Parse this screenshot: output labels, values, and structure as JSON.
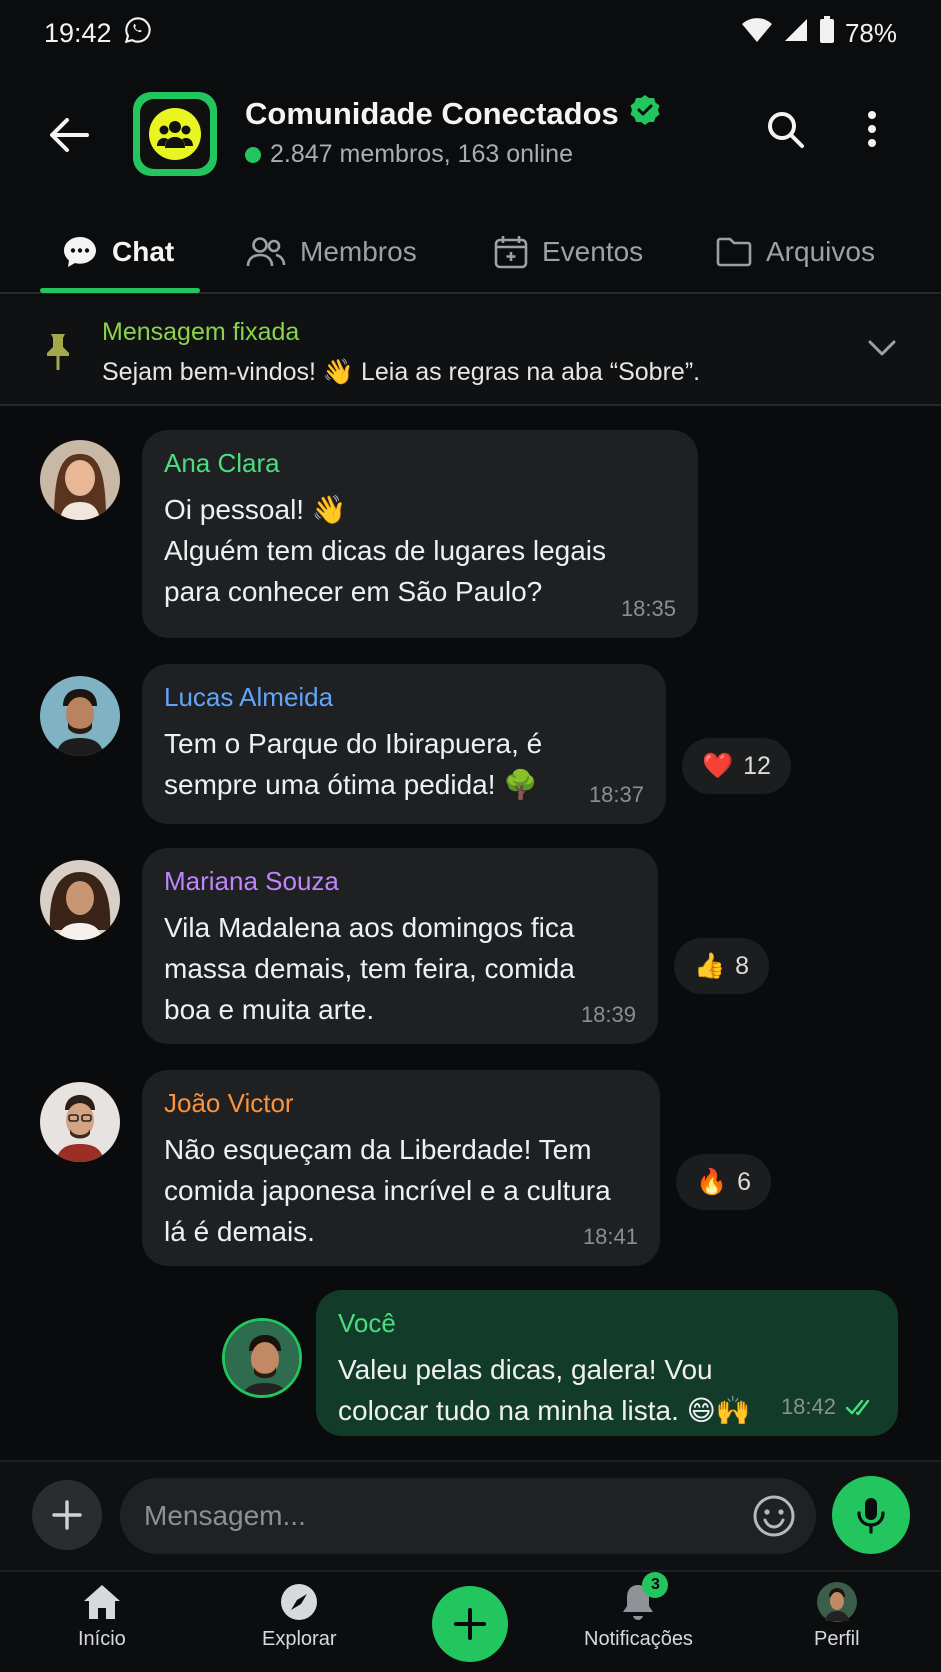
{
  "status_bar": {
    "time": "19:42",
    "battery": "78%"
  },
  "header": {
    "title": "Comunidade Conectados",
    "subtitle": "2.847 membros, 163 online"
  },
  "tabs": [
    {
      "label": "Chat",
      "icon": "chat-bubble-icon",
      "active": true
    },
    {
      "label": "Membros",
      "icon": "people-icon"
    },
    {
      "label": "Eventos",
      "icon": "calendar-icon"
    },
    {
      "label": "Arquivos",
      "icon": "folder-icon"
    }
  ],
  "pinned": {
    "title": "Mensagem fixada",
    "text": "Sejam bem-vindos! 👋 Leia as regras na aba “Sobre”."
  },
  "messages": [
    {
      "sender": "Ana Clara",
      "sender_color": "#4ade80",
      "lines": [
        "Oi pessoal! 👋",
        "Alguém tem dicas de lugares legais",
        "para conhecer em São Paulo?"
      ],
      "time": "18:35"
    },
    {
      "sender": "Lucas Almeida",
      "sender_color": "#60a5fa",
      "lines": [
        "Tem o Parque do Ibirapuera, é",
        "sempre uma ótima pedida! 🌳"
      ],
      "time": "18:37",
      "reaction": {
        "emoji": "❤️",
        "count": "12"
      }
    },
    {
      "sender": "Mariana Souza",
      "sender_color": "#c084fc",
      "lines": [
        "Vila Madalena aos domingos fica",
        "massa demais, tem feira, comida",
        "boa e muita arte."
      ],
      "time": "18:39",
      "reaction": {
        "emoji": "👍",
        "count": "8"
      }
    },
    {
      "sender": "João Victor",
      "sender_color": "#fb923c",
      "lines": [
        "Não esqueçam da Liberdade! Tem",
        "comida japonesa incrível e a cultura",
        "lá é demais."
      ],
      "time": "18:41",
      "reaction": {
        "emoji": "🔥",
        "count": "6"
      }
    },
    {
      "sender": "Você",
      "sender_color": "#4ade80",
      "lines": [
        "Valeu pelas dicas, galera! Vou",
        "colocar tudo na minha lista. 😄🙌"
      ],
      "time": "18:42",
      "read": true
    }
  ],
  "composer": {
    "placeholder": "Mensagem..."
  },
  "bottom_nav": [
    {
      "label": "Início",
      "icon": "home-icon"
    },
    {
      "label": "Explorar",
      "icon": "compass-icon"
    },
    {
      "label": "Notificações",
      "icon": "bell-icon",
      "badge": "3"
    },
    {
      "label": "Perfil",
      "icon": "profile-avatar"
    }
  ],
  "colors": {
    "accent": "#22c55e",
    "bubble": "#1e2022",
    "own_bubble": "#123b2a"
  }
}
